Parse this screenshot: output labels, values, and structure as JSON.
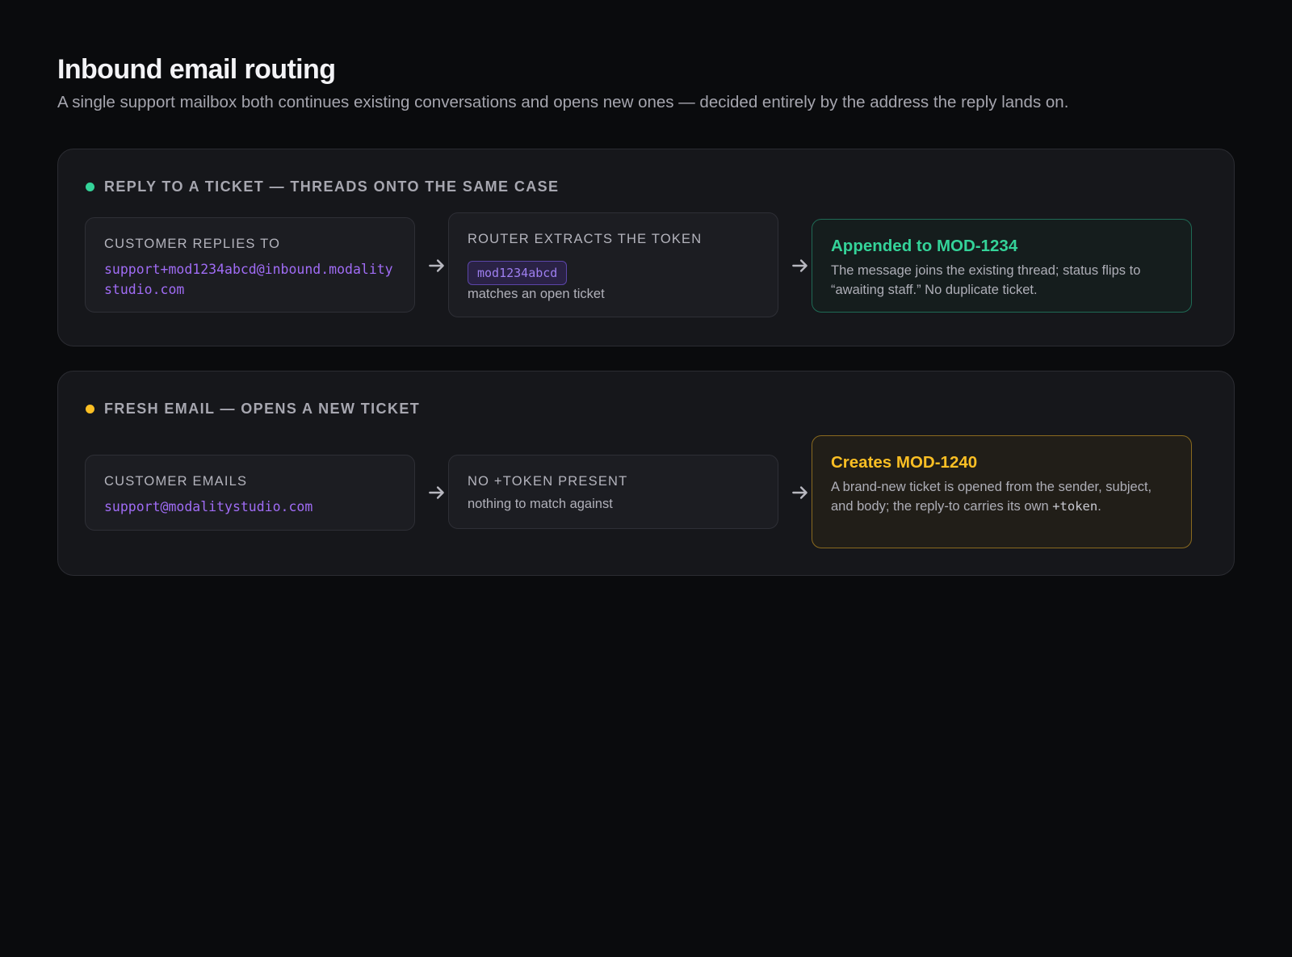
{
  "header": {
    "title": "Inbound email routing",
    "subtitle": "A single support mailbox both continues existing conversations and opens new ones — decided entirely by the address the reply lands on."
  },
  "flows": [
    {
      "title": "REPLY TO A TICKET — THREADS ONTO THE SAME CASE",
      "dot_color": "#34d399",
      "step1": {
        "label": "CUSTOMER REPLIES TO",
        "address": "support+mod1234abcd@inbound.modalitystudio.com"
      },
      "step2": {
        "label": "ROUTER EXTRACTS THE TOKEN",
        "token": "mod1234abcd",
        "note": "matches an open ticket"
      },
      "result": {
        "title": "Appended to MOD-1234",
        "description": "The message joins the existing thread; status flips to “awaiting staff.” No duplicate ticket."
      }
    },
    {
      "title": "FRESH EMAIL — OPENS A NEW TICKET",
      "dot_color": "#fbbf24",
      "step1": {
        "label": "CUSTOMER EMAILS",
        "address": "support@modalitystudio.com"
      },
      "step2": {
        "label": "NO +TOKEN PRESENT",
        "note": "nothing to match against"
      },
      "result": {
        "title": "Creates MOD-1240",
        "description_before": "A brand-new ticket is opened from the sender, subject, and body; the reply-to carries its own ",
        "description_code": "+token",
        "description_after": "."
      }
    }
  ],
  "icons": {
    "arrow": "arrow-right-icon",
    "status_dot": "status-dot-icon"
  }
}
